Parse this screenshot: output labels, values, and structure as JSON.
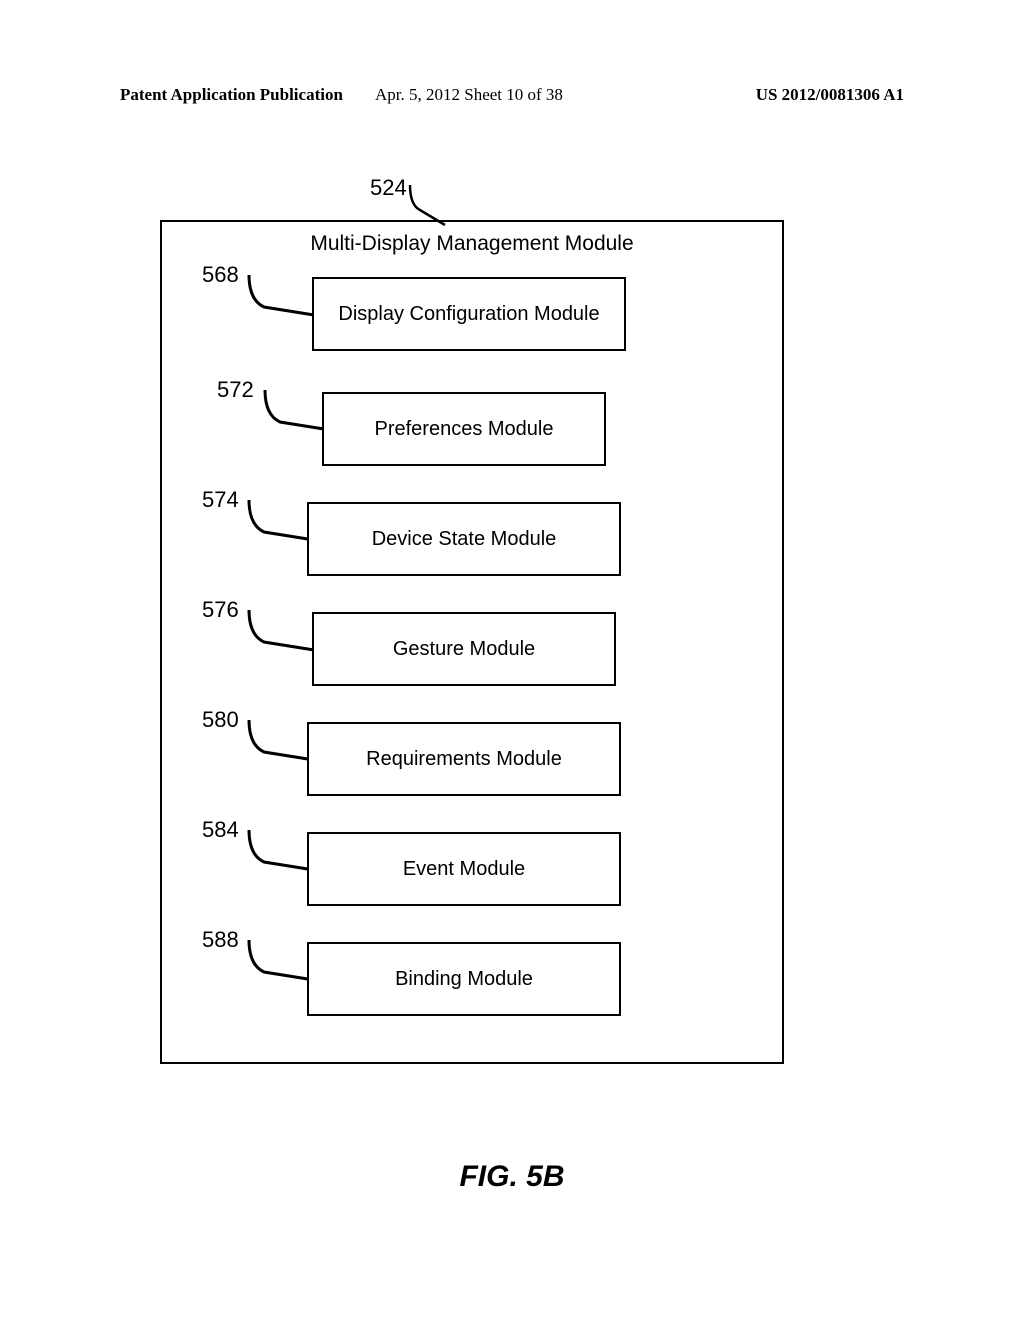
{
  "header": {
    "left": "Patent Application Publication",
    "mid": "Apr. 5, 2012   Sheet 10 of 38",
    "right": "US 2012/0081306 A1"
  },
  "diagram": {
    "title": "Multi-Display Management Module",
    "titleRef": "524",
    "modules": [
      {
        "ref": "568",
        "label": "Display Configuration Module"
      },
      {
        "ref": "572",
        "label": "Preferences Module"
      },
      {
        "ref": "574",
        "label": "Device State Module"
      },
      {
        "ref": "576",
        "label": "Gesture Module"
      },
      {
        "ref": "580",
        "label": "Requirements Module"
      },
      {
        "ref": "584",
        "label": "Event Module"
      },
      {
        "ref": "588",
        "label": "Binding Module"
      }
    ]
  },
  "figureCaption": "FIG. 5B"
}
